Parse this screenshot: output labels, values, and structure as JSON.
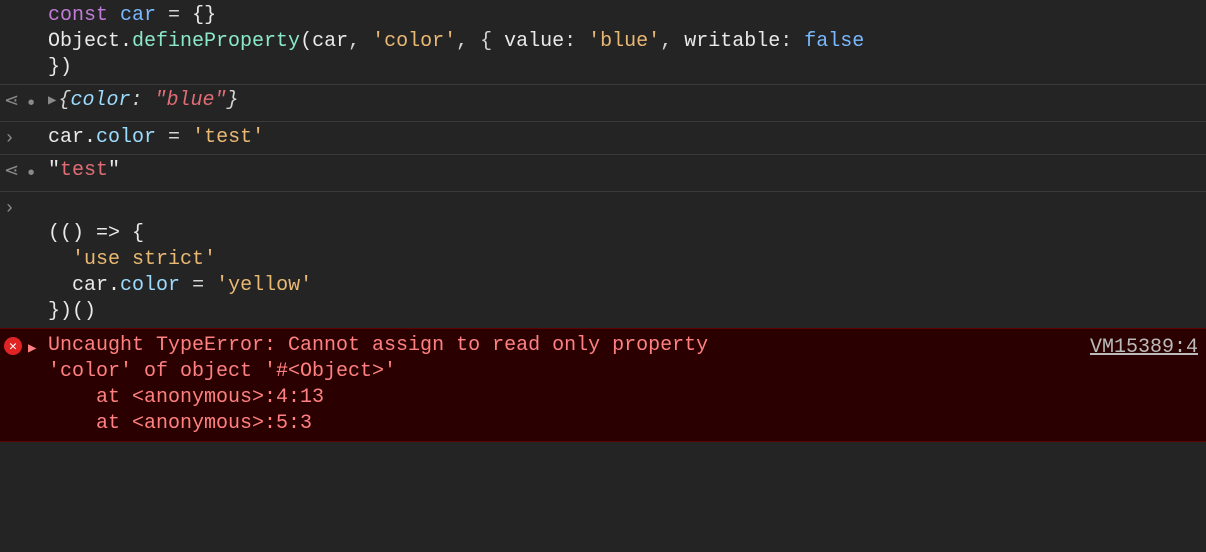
{
  "entries": {
    "line1": {
      "const": "const",
      "car": "car",
      "eq": " = ",
      "empty_obj": "{}",
      "object_word": "Object",
      "defineProperty": "defineProperty",
      "arg_car": "car",
      "str_color": "'color'",
      "key_value": "value",
      "str_blue": "'blue'",
      "key_writable": "writable",
      "false_lit": "false",
      "close": "})"
    },
    "result1": {
      "open": "{",
      "key_color": "color",
      "sep": ": ",
      "val_blue": "\"blue\"",
      "close": "}"
    },
    "line2": {
      "car": "car",
      "color": "color",
      "eq": " = ",
      "str_test": "'test'"
    },
    "result2": {
      "val": "\"test\""
    },
    "line3": {
      "l1": "(() => {",
      "l2_str": "'use strict'",
      "l3_car": "car",
      "l3_color": "color",
      "l3_eq": " = ",
      "l3_str": "'yellow'",
      "l4": "})()"
    }
  },
  "error": {
    "message_l1": "Uncaught TypeError: Cannot assign to read only property ",
    "message_l2": "'color' of object '#<Object>'",
    "stack1": "    at <anonymous>:4:13",
    "stack2": "    at <anonymous>:5:3",
    "source_link": "VM15389:4"
  }
}
